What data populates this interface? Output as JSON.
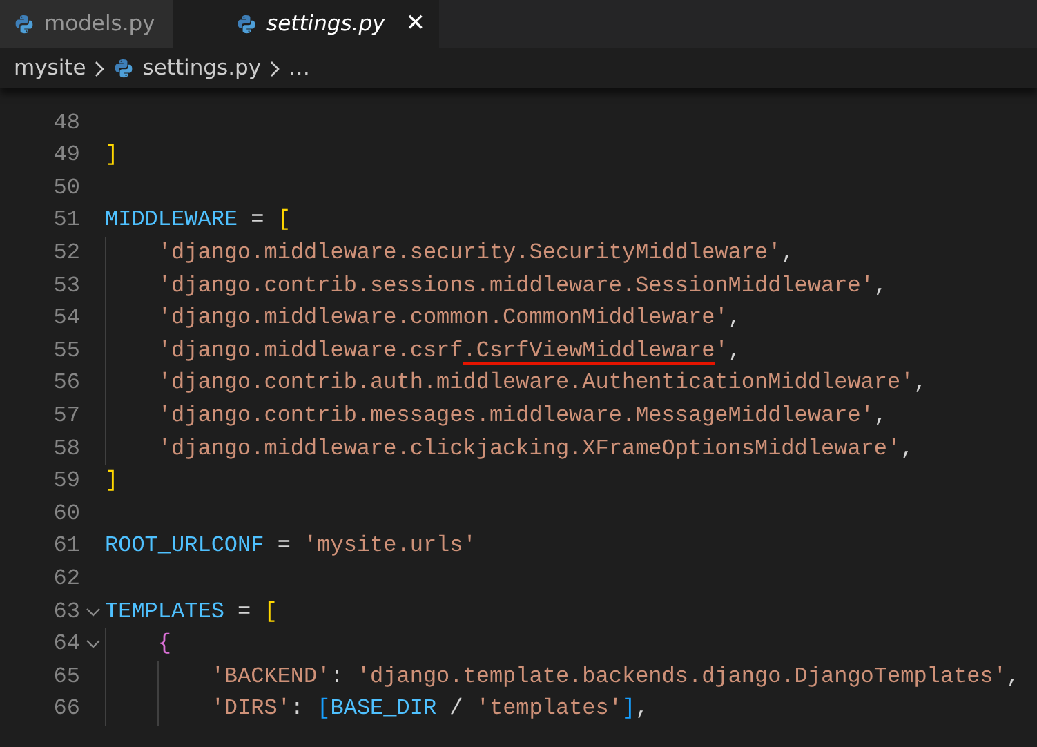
{
  "tabs": [
    {
      "label": "models.py",
      "selected": false,
      "preview": false
    },
    {
      "label": "settings.py",
      "selected": true,
      "preview": true,
      "close": "✕"
    }
  ],
  "breadcrumb": {
    "items": [
      {
        "label": "mysite",
        "file": false
      },
      {
        "label": "settings.py",
        "file": true
      }
    ],
    "more": "…"
  },
  "lines": [
    {
      "number": "48",
      "foldable": false
    },
    {
      "number": "49",
      "foldable": false,
      "tokens": [
        {
          "kind": "bracket",
          "text": "]"
        }
      ]
    },
    {
      "number": "50",
      "foldable": false
    },
    {
      "number": "51",
      "foldable": false,
      "tokens": [
        {
          "kind": "constant",
          "text": "MIDDLEWARE"
        },
        {
          "kind": "plain",
          "text": " = "
        },
        {
          "kind": "bracket",
          "text": "["
        }
      ]
    },
    {
      "number": "52",
      "foldable": false,
      "tokens": [
        {
          "kind": "string",
          "text": "    'django.middleware.security.SecurityMiddleware'"
        },
        {
          "kind": "plain",
          "text": ","
        }
      ]
    },
    {
      "number": "53",
      "foldable": false,
      "tokens": [
        {
          "kind": "string",
          "text": "    'django.contrib.sessions.middleware.SessionMiddleware'"
        },
        {
          "kind": "plain",
          "text": ","
        }
      ]
    },
    {
      "number": "54",
      "foldable": false,
      "tokens": [
        {
          "kind": "string",
          "text": "    'django.middleware.common.CommonMiddleware'"
        },
        {
          "kind": "plain",
          "text": ","
        }
      ]
    },
    {
      "number": "55",
      "foldable": false,
      "tokens": [
        {
          "kind": "string",
          "text": "    'django.middleware.csrf"
        },
        {
          "kind": "string",
          "text": ".CsrfViewMiddleware",
          "underlined": true
        },
        {
          "kind": "string",
          "text": "'"
        },
        {
          "kind": "plain",
          "text": ","
        }
      ]
    },
    {
      "number": "56",
      "foldable": false,
      "tokens": [
        {
          "kind": "string",
          "text": "    'django.contrib.auth.middleware.AuthenticationMiddleware'"
        },
        {
          "kind": "plain",
          "text": ","
        }
      ]
    },
    {
      "number": "57",
      "foldable": false,
      "tokens": [
        {
          "kind": "string",
          "text": "    'django.contrib.messages.middleware.MessageMiddleware'"
        },
        {
          "kind": "plain",
          "text": ","
        }
      ]
    },
    {
      "number": "58",
      "foldable": false,
      "tokens": [
        {
          "kind": "string",
          "text": "    'django.middleware.clickjacking.XFrameOptionsMiddleware'"
        },
        {
          "kind": "plain",
          "text": ","
        }
      ]
    },
    {
      "number": "59",
      "foldable": false,
      "tokens": [
        {
          "kind": "bracket",
          "text": "]"
        }
      ]
    },
    {
      "number": "60",
      "foldable": false
    },
    {
      "number": "61",
      "foldable": false,
      "tokens": [
        {
          "kind": "constant",
          "text": "ROOT_URLCONF"
        },
        {
          "kind": "plain",
          "text": " = "
        },
        {
          "kind": "string",
          "text": "'mysite.urls'"
        }
      ]
    },
    {
      "number": "62",
      "foldable": false
    },
    {
      "number": "63",
      "foldable": true,
      "tokens": [
        {
          "kind": "constant",
          "text": "TEMPLATES"
        },
        {
          "kind": "plain",
          "text": " = "
        },
        {
          "kind": "bracket",
          "text": "["
        }
      ]
    },
    {
      "number": "64",
      "foldable": true,
      "tokens": [
        {
          "kind": "brace",
          "text": "    {"
        }
      ]
    },
    {
      "number": "65",
      "foldable": false,
      "tokens": [
        {
          "kind": "string",
          "text": "        'BACKEND'"
        },
        {
          "kind": "plain",
          "text": ": "
        },
        {
          "kind": "string",
          "text": "'django.template.backends.django.DjangoTemplates'"
        },
        {
          "kind": "plain",
          "text": ","
        }
      ]
    },
    {
      "number": "66",
      "foldable": false,
      "tokens": [
        {
          "kind": "string",
          "text": "        'DIRS'"
        },
        {
          "kind": "plain",
          "text": ": "
        },
        {
          "kind": "inner-bracket",
          "text": "["
        },
        {
          "kind": "constant",
          "text": "BASE_DIR"
        },
        {
          "kind": "plain",
          "text": " / "
        },
        {
          "kind": "string",
          "text": "'templates'"
        },
        {
          "kind": "inner-bracket",
          "text": "]"
        },
        {
          "kind": "plain",
          "text": ","
        }
      ]
    }
  ]
}
